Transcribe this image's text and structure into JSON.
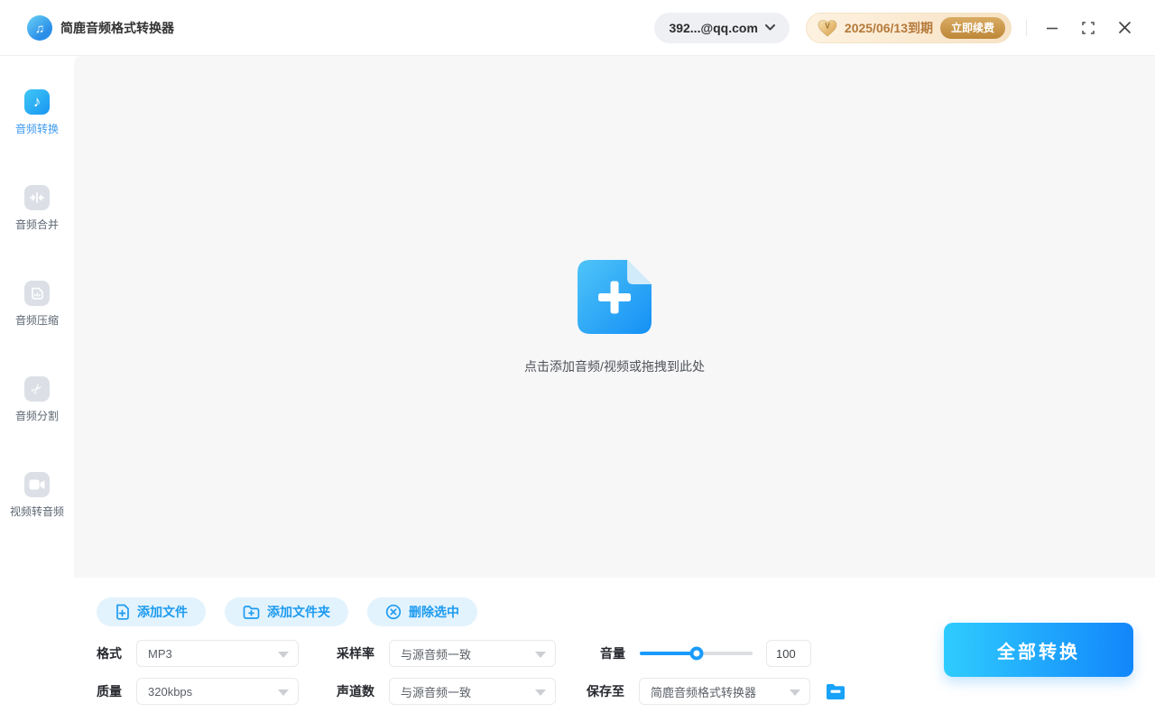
{
  "app": {
    "title": "简鹿音频格式转换器"
  },
  "titlebar": {
    "account": "392...@qq.com",
    "vip": {
      "expiry": "2025/06/13到期",
      "renew": "立即续费"
    }
  },
  "sidebar": [
    {
      "label": "音频转换",
      "icon": "music-note-icon",
      "active": true
    },
    {
      "label": "音频合并",
      "icon": "merge-icon",
      "active": false
    },
    {
      "label": "音频压缩",
      "icon": "compress-icon",
      "active": false
    },
    {
      "label": "音频分割",
      "icon": "scissors-icon",
      "active": false
    },
    {
      "label": "视频转音频",
      "icon": "video-icon",
      "active": false
    }
  ],
  "dropzone": {
    "hint": "点击添加音频/视频或拖拽到此处"
  },
  "toolbar": {
    "add_file": "添加文件",
    "add_folder": "添加文件夹",
    "delete_selected": "删除选中"
  },
  "settings": {
    "format": {
      "label": "格式",
      "value": "MP3"
    },
    "sample_rate": {
      "label": "采样率",
      "value": "与源音频一致"
    },
    "volume": {
      "label": "音量",
      "value": "100",
      "percent": 50
    },
    "quality": {
      "label": "质量",
      "value": "320kbps"
    },
    "channels": {
      "label": "声道数",
      "value": "与源音频一致"
    },
    "save_to": {
      "label": "保存至",
      "value": "简鹿音频格式转换器"
    }
  },
  "actions": {
    "convert_all": "全部转换"
  },
  "colors": {
    "primary_blue": "#1a9bfc",
    "convert_gradient_start": "#2fccfe",
    "convert_gradient_end": "#1286fb",
    "light_blue_button": "#e3f3fd",
    "vip_text": "#b5793a",
    "vip_button_gold": "#bd8738",
    "drop_area_bg": "#f7f7f8"
  }
}
